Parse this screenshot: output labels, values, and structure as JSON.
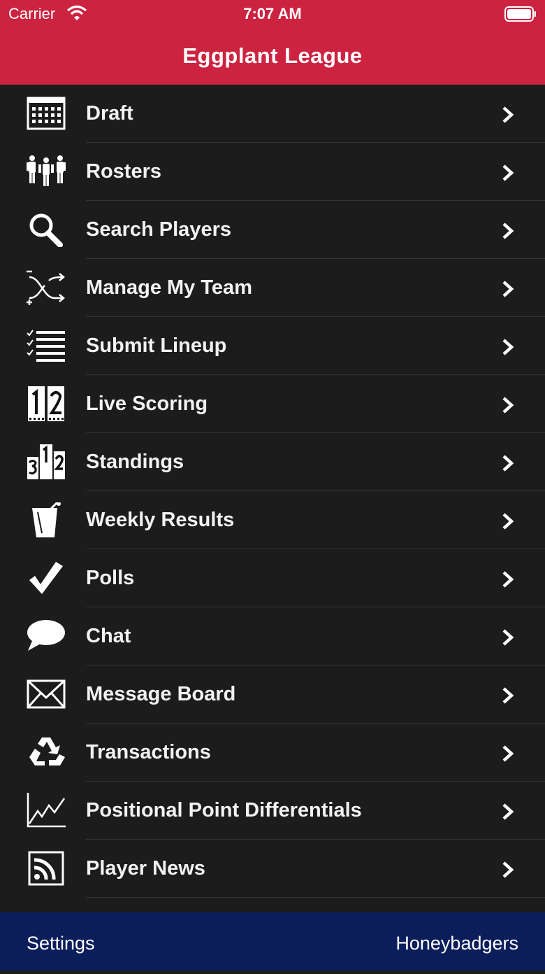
{
  "status_bar": {
    "carrier": "Carrier",
    "time": "7:07 AM"
  },
  "header": {
    "title": "Eggplant League"
  },
  "menu": {
    "items": [
      {
        "label": "Draft",
        "icon": "calendar-grid-icon"
      },
      {
        "label": "Rosters",
        "icon": "people-group-icon"
      },
      {
        "label": "Search Players",
        "icon": "magnifier-icon"
      },
      {
        "label": "Manage My Team",
        "icon": "shuffle-icon"
      },
      {
        "label": "Submit Lineup",
        "icon": "checklist-icon"
      },
      {
        "label": "Live Scoring",
        "icon": "scoreboard-icon"
      },
      {
        "label": "Standings",
        "icon": "podium-icon"
      },
      {
        "label": "Weekly Results",
        "icon": "drink-cup-icon"
      },
      {
        "label": "Polls",
        "icon": "checkmark-icon"
      },
      {
        "label": "Chat",
        "icon": "speech-bubble-icon"
      },
      {
        "label": "Message Board",
        "icon": "envelope-icon"
      },
      {
        "label": "Transactions",
        "icon": "recycle-icon"
      },
      {
        "label": "Positional Point Differentials",
        "icon": "line-chart-icon"
      },
      {
        "label": "Player News",
        "icon": "rss-feed-icon"
      }
    ]
  },
  "tab_bar": {
    "settings_label": "Settings",
    "team_label": "Honeybadgers"
  },
  "colors": {
    "header": "#cc2340",
    "background": "#1c1c1d",
    "tab_bar": "#0b1e5b"
  }
}
